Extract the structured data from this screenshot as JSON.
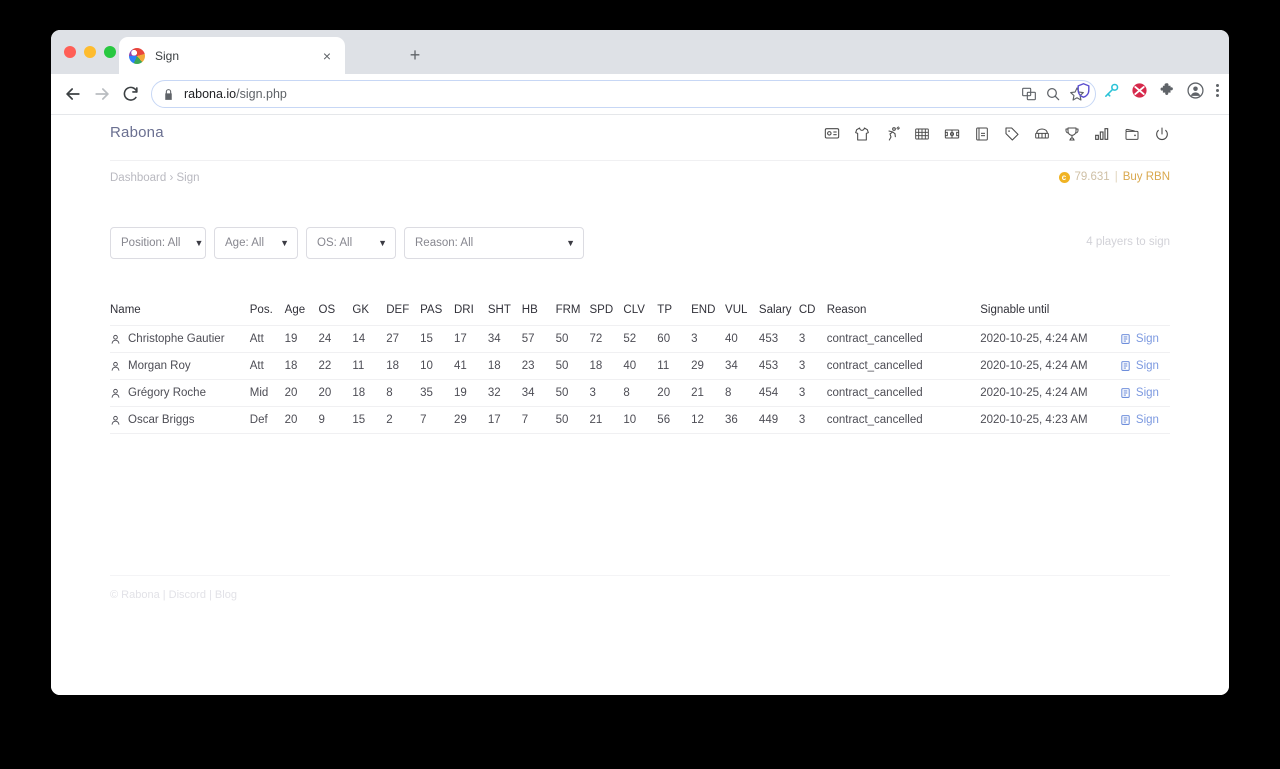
{
  "browser": {
    "tab": {
      "title": "Sign",
      "favicon": "rabona-favicon-icon",
      "close": "×"
    },
    "new_tab": "+",
    "url_host": "rabona.io",
    "url_path": "/sign.php",
    "toolbar_icons": [
      "translate-icon",
      "search-icon",
      "bookmark-star-icon"
    ],
    "extension_icons": [
      "shield-extension-icon",
      "key-extension-icon",
      "pocket-extension-icon",
      "puzzle-extensions-icon",
      "profile-avatar-icon",
      "chrome-menu-icon"
    ]
  },
  "app": {
    "brand": "Rabona",
    "nav_icons": [
      "dashboard-icon",
      "squad-kit-icon",
      "training-icon",
      "tactics-pitch-icon",
      "match-icon",
      "news-icon",
      "transfers-tag-icon",
      "stadium-icon",
      "trophy-icon",
      "stats-bars-icon",
      "finances-wallet-icon",
      "logout-power-icon"
    ],
    "breadcrumb": "Dashboard › Sign",
    "balance": {
      "icon": "coin-icon",
      "symbol": "c",
      "amount": "79.631",
      "separator": "|",
      "buy_label": "Buy RBN"
    }
  },
  "filters": {
    "selects": [
      {
        "name": "position-filter",
        "label": "Position: All",
        "caret": "▼"
      },
      {
        "name": "age-filter",
        "label": "Age: All",
        "caret": "▼"
      },
      {
        "name": "os-filter",
        "label": "OS: All",
        "caret": "▼"
      },
      {
        "name": "reason-filter",
        "label": "Reason: All",
        "caret": "▼"
      }
    ],
    "count_text": "4 players to sign"
  },
  "table": {
    "columns": [
      "Name",
      "Pos.",
      "Age",
      "OS",
      "GK",
      "DEF",
      "PAS",
      "DRI",
      "SHT",
      "HB",
      "FRM",
      "SPD",
      "CLV",
      "TP",
      "END",
      "VUL",
      "Salary",
      "CD",
      "Reason",
      "Signable until"
    ],
    "action_label": "Sign",
    "rows": [
      {
        "name": "Christophe Gautier",
        "pos": "Att",
        "age": "19",
        "os": "24",
        "gk": "14",
        "def": "27",
        "pas": "15",
        "dri": "17",
        "sht": "34",
        "hb": "57",
        "frm": "50",
        "spd": "72",
        "clv": "52",
        "tp": "60",
        "end": "3",
        "vul": "40",
        "salary": "453",
        "cd": "3",
        "reason": "contract_cancelled",
        "until": "2020-10-25, 4:24 AM",
        "action": "Sign"
      },
      {
        "name": "Morgan  Roy",
        "pos": "Att",
        "age": "18",
        "os": "22",
        "gk": "11",
        "def": "18",
        "pas": "10",
        "dri": "41",
        "sht": "18",
        "hb": "23",
        "frm": "50",
        "spd": "18",
        "clv": "40",
        "tp": "11",
        "end": "29",
        "vul": "34",
        "salary": "453",
        "cd": "3",
        "reason": "contract_cancelled",
        "until": "2020-10-25, 4:24 AM",
        "action": "Sign"
      },
      {
        "name": "Grégory Roche",
        "pos": "Mid",
        "age": "20",
        "os": "20",
        "gk": "18",
        "def": "8",
        "pas": "35",
        "dri": "19",
        "sht": "32",
        "hb": "34",
        "frm": "50",
        "spd": "3",
        "clv": "8",
        "tp": "20",
        "end": "21",
        "vul": "8",
        "salary": "454",
        "cd": "3",
        "reason": "contract_cancelled",
        "until": "2020-10-25, 4:24 AM",
        "action": "Sign"
      },
      {
        "name": "Oscar Briggs",
        "pos": "Def",
        "age": "20",
        "os": "9",
        "gk": "15",
        "def": "2",
        "pas": "7",
        "dri": "29",
        "sht": "17",
        "hb": "7",
        "frm": "50",
        "spd": "21",
        "clv": "10",
        "tp": "56",
        "end": "12",
        "vul": "36",
        "salary": "449",
        "cd": "3",
        "reason": "contract_cancelled",
        "until": "2020-10-25, 4:23 AM",
        "action": "Sign"
      }
    ]
  },
  "footer": {
    "text": "© Rabona | Discord | Blog"
  },
  "colors": {
    "brand": "#6b7091",
    "os_green": "#7cb87c",
    "link_blue": "#7d9ae0",
    "gold": "#d9a84e"
  }
}
